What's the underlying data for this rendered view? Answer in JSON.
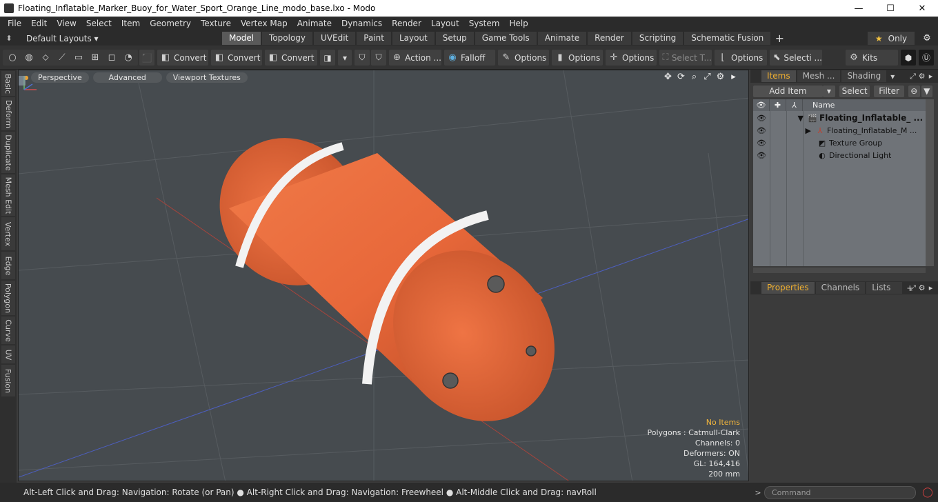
{
  "window": {
    "title": "Floating_Inflatable_Marker_Buoy_for_Water_Sport_Orange_Line_modo_base.lxo - Modo",
    "minimize": "—",
    "maximize": "☐",
    "close": "✕"
  },
  "menu": [
    "File",
    "Edit",
    "View",
    "Select",
    "Item",
    "Geometry",
    "Texture",
    "Vertex Map",
    "Animate",
    "Dynamics",
    "Render",
    "Layout",
    "System",
    "Help"
  ],
  "layout": {
    "default_layouts": "Default Layouts ▾",
    "tabs": [
      "Model",
      "Topology",
      "UVEdit",
      "Paint",
      "Layout",
      "Setup",
      "Game Tools",
      "Animate",
      "Render",
      "Scripting",
      "Schematic Fusion"
    ],
    "active_tab": "Model",
    "plus": "+",
    "only": "Only"
  },
  "toolbar": {
    "convert1": "Convert",
    "convert2": "Convert",
    "convert3": "Convert",
    "action": "Action ...",
    "falloff": "Falloff",
    "options1": "Options",
    "options2": "Options",
    "options3": "Options",
    "select_t": "Select T...",
    "options4": "Options",
    "selecti": "Selecti ...",
    "kits": "Kits"
  },
  "left_tabs": [
    "Basic",
    "Deform",
    "Duplicate",
    "Mesh Edit",
    "Vertex",
    "Edge",
    "Polygon",
    "Curve",
    "UV",
    "Fusion"
  ],
  "viewport": {
    "perspective": "Perspective",
    "advanced": "Advanced",
    "textures": "Viewport Textures",
    "info": {
      "no_items": "No Items",
      "polygons": "Polygons : Catmull-Clark",
      "channels": "Channels: 0",
      "deformers": "Deformers: ON",
      "gl": "GL: 164,416",
      "scale": "200 mm"
    },
    "colors": {
      "buoy": "#e8683a",
      "stripe": "#f2f2f2",
      "background": "#464b4f"
    }
  },
  "items_panel": {
    "tabs": [
      "Items",
      "Mesh ...",
      "Shading"
    ],
    "add_item": "Add Item",
    "select": "Select",
    "filter": "Filter",
    "name_header": "Name",
    "rows": [
      {
        "label": "Floating_Inflatable_ ..."
      },
      {
        "label": "Floating_Inflatable_M ..."
      },
      {
        "label": "Texture Group"
      },
      {
        "label": "Directional Light"
      }
    ]
  },
  "properties_panel": {
    "tabs": [
      "Properties",
      "Channels",
      "Lists"
    ],
    "plus": "+"
  },
  "status": {
    "hint": "Alt-Left Click and Drag: Navigation: Rotate (or Pan) ● Alt-Right Click and Drag: Navigation: Freewheel ● Alt-Middle Click and Drag: navRoll",
    "command_placeholder": "Command"
  }
}
